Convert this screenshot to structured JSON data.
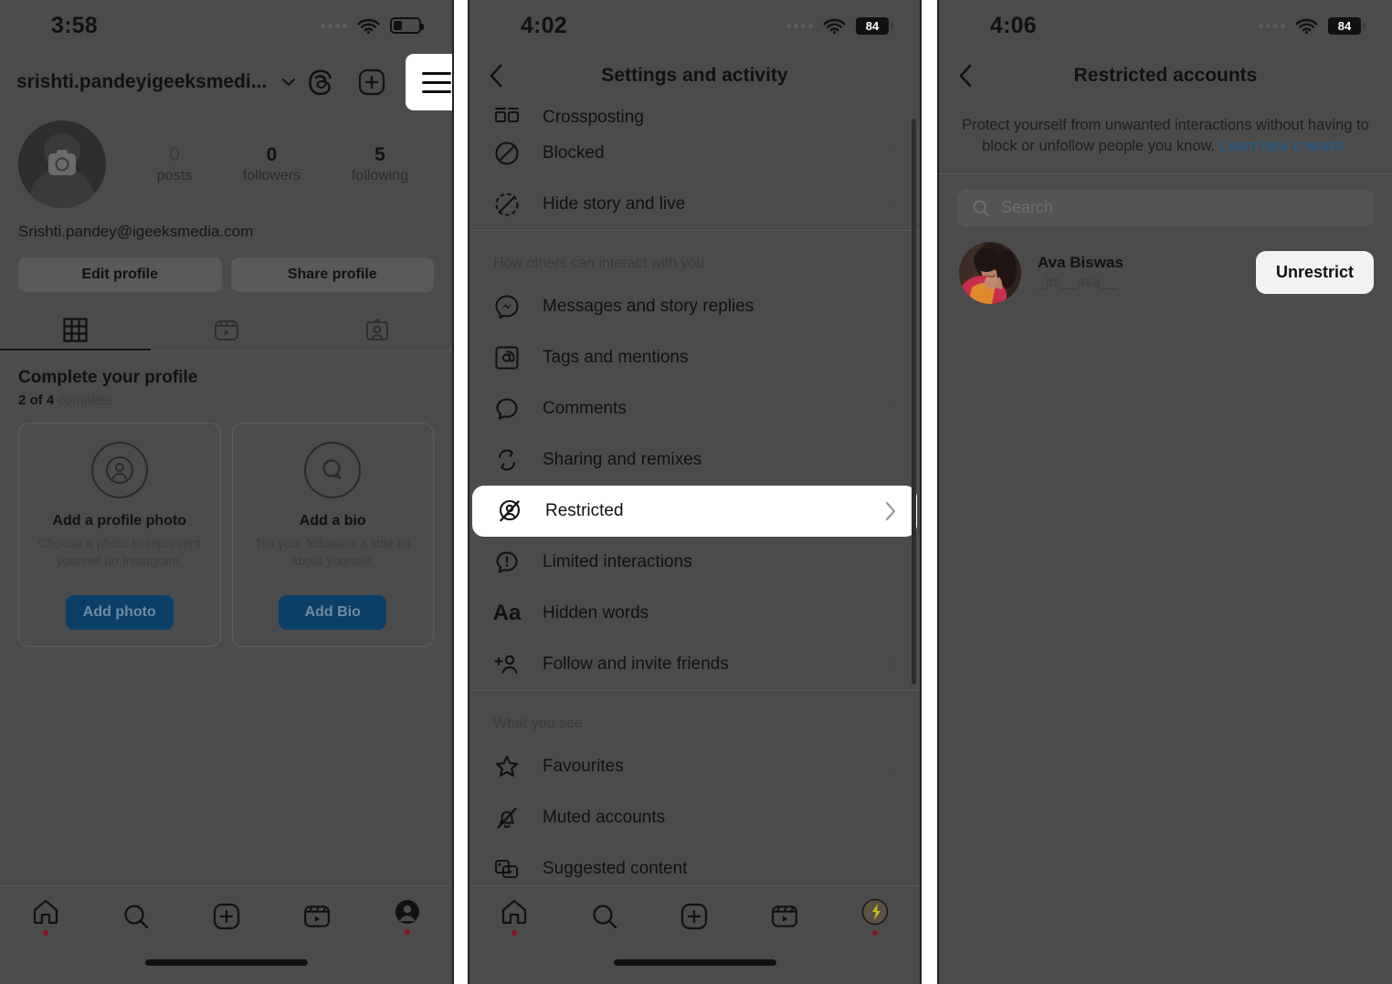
{
  "panel1": {
    "status": {
      "time": "3:58",
      "signal": "signal-dots",
      "wifi": "wifi-icon",
      "battery_level_pct": 35
    },
    "header": {
      "username": "srishti.pandeyigeeksmedi...",
      "chevron": "chevron-down-icon",
      "threads_icon": "threads-icon",
      "add_icon": "plus-square-icon",
      "menu_icon": "hamburger-menu-icon"
    },
    "stats": [
      {
        "num": "0",
        "label": "posts"
      },
      {
        "num": "0",
        "label": "followers"
      },
      {
        "num": "5",
        "label": "following"
      }
    ],
    "email": "Srishti.pandey@igeeksmedia.com",
    "buttons": {
      "edit": "Edit profile",
      "share": "Share profile"
    },
    "tabs": [
      {
        "name": "grid-tab",
        "icon": "grid-icon",
        "active": true
      },
      {
        "name": "reels-tab",
        "icon": "reels-icon",
        "active": false
      },
      {
        "name": "tagged-tab",
        "icon": "tagged-icon",
        "active": false
      }
    ],
    "complete": {
      "title": "Complete your profile",
      "progress_bold": "2 of 4",
      "progress_rest": "complete",
      "cards": [
        {
          "icon": "person-circle-icon",
          "title": "Add a profile photo",
          "desc": "Choose a photo to represent yourself on Instagram.",
          "button": "Add photo"
        },
        {
          "icon": "comment-circle-icon",
          "title": "Add a bio",
          "desc": "Tell your followers a little bit about yourself.",
          "button": "Add Bio"
        }
      ]
    },
    "bottomnav": [
      {
        "name": "home",
        "icon": "home-icon",
        "dot": true
      },
      {
        "name": "search",
        "icon": "search-icon",
        "dot": false
      },
      {
        "name": "create",
        "icon": "plus-square-icon",
        "dot": false
      },
      {
        "name": "reels",
        "icon": "reels-icon",
        "dot": false
      },
      {
        "name": "profile",
        "icon": "profile-avatar-icon",
        "dot": true
      }
    ]
  },
  "panel2": {
    "status": {
      "time": "4:02",
      "battery_label": "84"
    },
    "header": {
      "back": "back-chevron-icon",
      "title": "Settings and activity"
    },
    "rows_top": [
      {
        "icon": "crossposting-icon",
        "label": "Crossposting"
      },
      {
        "icon": "blocked-icon",
        "label": "Blocked"
      },
      {
        "icon": "hide-story-icon",
        "label": "Hide story and live"
      }
    ],
    "section1_heading": "How others can interact with you",
    "rows_mid": [
      {
        "icon": "messenger-icon",
        "label": "Messages and story replies",
        "highlight": false
      },
      {
        "icon": "at-icon",
        "label": "Tags and mentions",
        "highlight": false
      },
      {
        "icon": "comment-icon",
        "label": "Comments",
        "highlight": false
      },
      {
        "icon": "remix-icon",
        "label": "Sharing and remixes",
        "highlight": false
      },
      {
        "icon": "restricted-icon",
        "label": "Restricted",
        "highlight": true
      },
      {
        "icon": "limited-icon",
        "label": "Limited interactions",
        "highlight": false
      },
      {
        "icon": "hidden-words-icon",
        "label": "Hidden words",
        "highlight": false
      },
      {
        "icon": "follow-invite-icon",
        "label": "Follow and invite friends",
        "highlight": false
      }
    ],
    "section2_heading": "What you see",
    "rows_bottom": [
      {
        "icon": "star-icon",
        "label": "Favourites"
      },
      {
        "icon": "muted-icon",
        "label": "Muted accounts"
      },
      {
        "icon": "suggested-content-icon",
        "label": "Suggested content"
      }
    ],
    "bottomnav": [
      {
        "name": "home",
        "icon": "home-icon",
        "dot": true
      },
      {
        "name": "search",
        "icon": "search-icon",
        "dot": false
      },
      {
        "name": "create",
        "icon": "plus-square-icon",
        "dot": false
      },
      {
        "name": "reels",
        "icon": "reels-icon",
        "dot": false
      },
      {
        "name": "profile",
        "icon": "profile-avatar-icon",
        "dot": true
      }
    ]
  },
  "panel3": {
    "status": {
      "time": "4:06",
      "battery_label": "84"
    },
    "header": {
      "back": "back-chevron-icon",
      "title": "Restricted accounts"
    },
    "description": "Protect yourself from unwanted interactions without having to block or unfollow people you know.",
    "description_link": "Learn how it works.",
    "search": {
      "icon": "search-icon",
      "placeholder": "Search",
      "value": ""
    },
    "accounts": [
      {
        "avatar": "user-photo-avatar",
        "name": "Ava Biswas",
        "handle": "_its__ava__",
        "action": "Unrestrict"
      }
    ]
  },
  "colors": {
    "dim_overlay": "#4b4b4b",
    "highlight_white": "#ffffff",
    "link_blue": "#1b6091",
    "button_blue": "#0b3f68",
    "notification_red": "#b4101c"
  }
}
